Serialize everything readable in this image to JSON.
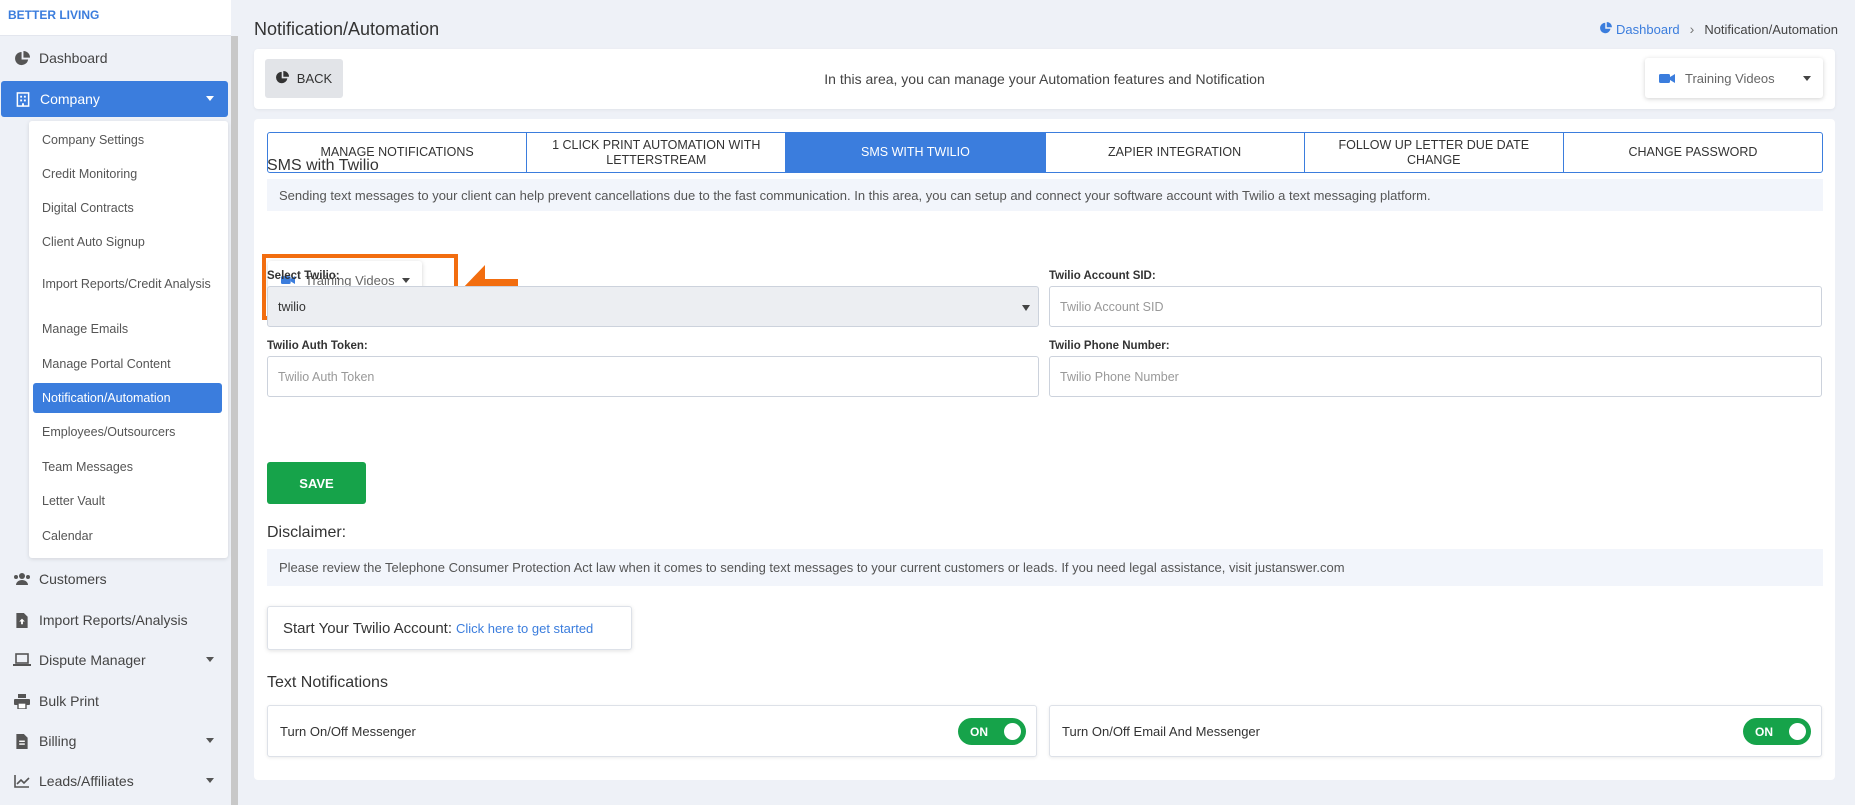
{
  "sidebar": {
    "brand": "BETTER LIVING",
    "items": [
      {
        "label": "Dashboard"
      },
      {
        "label": "Company"
      },
      {
        "label": "Customers"
      },
      {
        "label": "Import Reports/Analysis"
      },
      {
        "label": "Dispute Manager"
      },
      {
        "label": "Bulk Print"
      },
      {
        "label": "Billing"
      },
      {
        "label": "Leads/Affiliates"
      }
    ],
    "company_submenu": [
      "Company Settings",
      "Credit Monitoring",
      "Digital Contracts",
      "Client Auto Signup",
      "Import Reports/Credit Analysis",
      "Manage Emails",
      "Manage Portal Content",
      "Notification/Automation",
      "Employees/Outsourcers",
      "Team Messages",
      "Letter Vault",
      "Calendar"
    ]
  },
  "header": {
    "title": "Notification/Automation",
    "breadcrumb": {
      "home": "Dashboard",
      "current": "Notification/Automation"
    }
  },
  "topbar": {
    "back_label": "BACK",
    "info": "In this area, you can manage your Automation features and Notification",
    "training_videos": "Training Videos"
  },
  "tabs": [
    "MANAGE NOTIFICATIONS",
    "1 CLICK PRINT AUTOMATION WITH LETTERSTREAM",
    "SMS WITH TWILIO",
    "ZAPIER INTEGRATION",
    "FOLLOW UP LETTER DUE DATE CHANGE",
    "CHANGE PASSWORD"
  ],
  "sms": {
    "title": "SMS with Twilio",
    "intro": "Sending text messages to your client can help prevent cancellations due to the fast communication. In this area, you can setup and connect your software account with Twilio a text messaging platform.",
    "training_videos": "Training Videos",
    "select_twilio_label": "Select Twilio:",
    "select_twilio_value": "twilio",
    "account_sid_label": "Twilio Account SID:",
    "account_sid_placeholder": "Twilio Account SID",
    "auth_token_label": "Twilio Auth Token:",
    "auth_token_placeholder": "Twilio Auth Token",
    "phone_label": "Twilio Phone Number:",
    "phone_placeholder": "Twilio Phone Number",
    "save_label": "SAVE"
  },
  "disclaimer": {
    "title": "Disclaimer:",
    "text": "Please review the Telephone Consumer Protection Act law when it comes to sending text messages to your current customers or leads. If you need legal assistance, visit justanswer.com"
  },
  "start_account": {
    "label": "Start Your Twilio Account:",
    "link": "Click here to get started"
  },
  "text_notifications": {
    "title": "Text Notifications",
    "toggles": [
      {
        "label": "Turn On/Off Messenger",
        "state": "ON"
      },
      {
        "label": "Turn On/Off Email And Messenger",
        "state": "ON"
      }
    ]
  },
  "colors": {
    "accent": "#3b7ddd",
    "success": "#16a34a",
    "highlight": "#f26d0f"
  }
}
